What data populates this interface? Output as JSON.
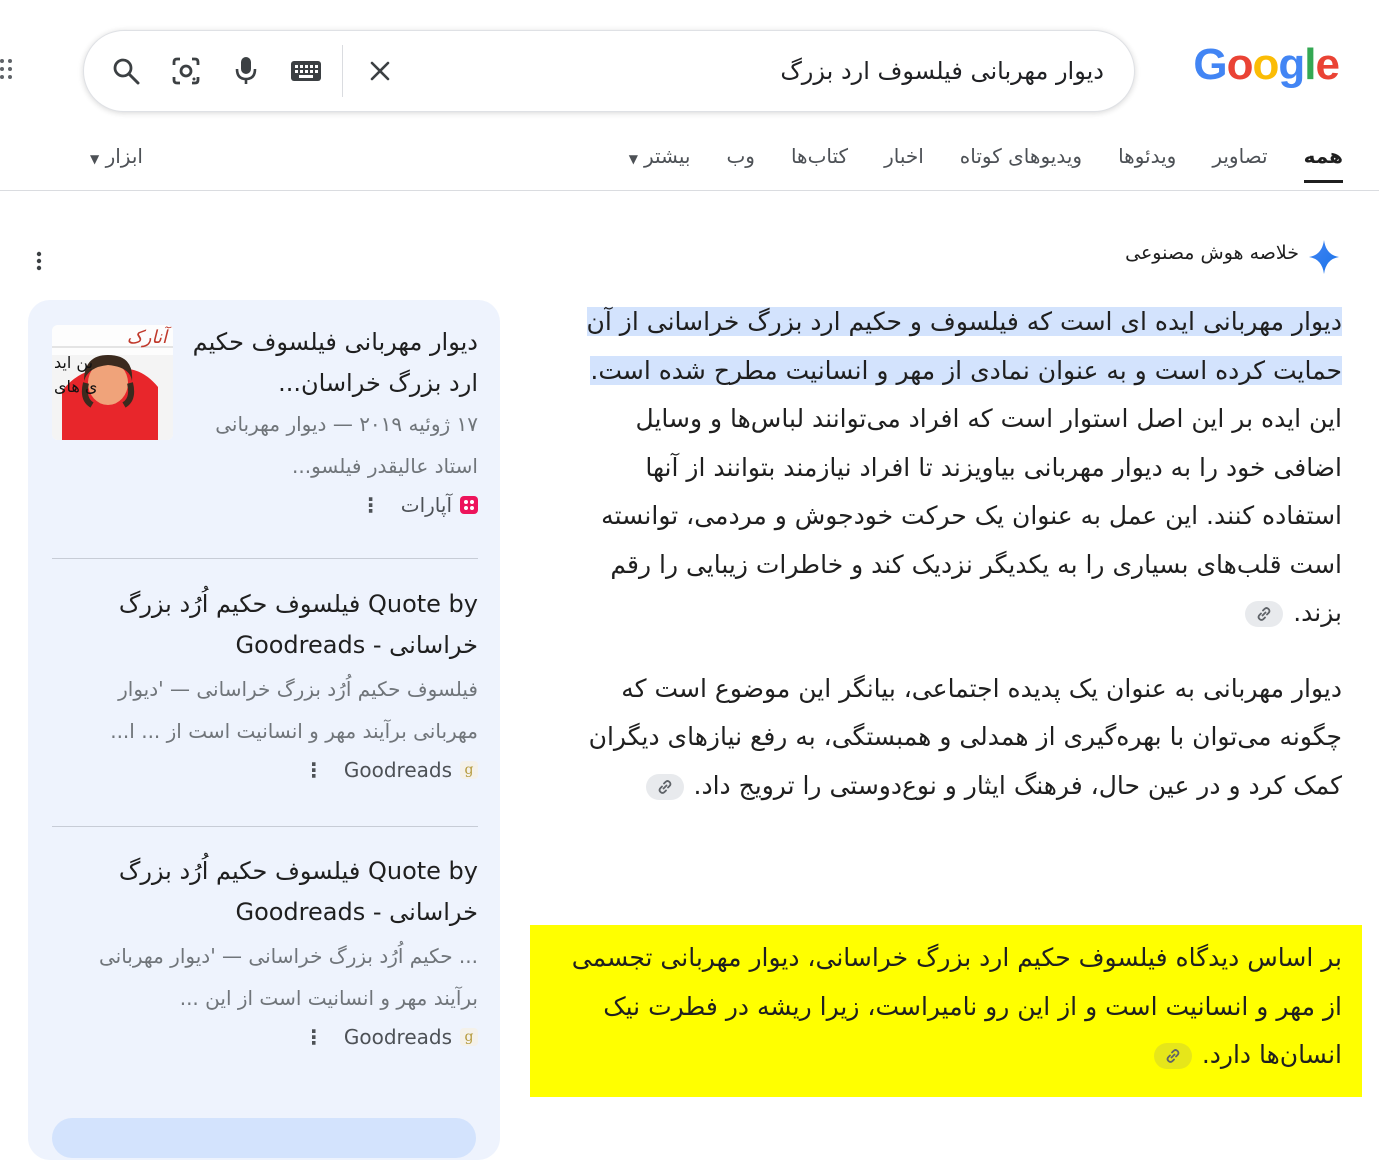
{
  "header": {
    "logo_letters": [
      "G",
      "o",
      "o",
      "g",
      "l",
      "e"
    ],
    "logo_colors": [
      "#4285f4",
      "#ea4335",
      "#fbbc05",
      "#4285f4",
      "#34a853",
      "#ea4335"
    ],
    "search_query": "دیوار مهربانی فیلسوف ارد بزرگ",
    "icons": [
      "search-icon",
      "lens-icon",
      "mic-icon",
      "keyboard-icon",
      "clear-icon",
      "apps-icon"
    ]
  },
  "tabs": {
    "items": [
      "همه",
      "تصاویر",
      "ویدئوها",
      "ویدیوهای کوتاه",
      "اخبار",
      "کتاب‌ها",
      "وب",
      "بیشتر"
    ],
    "active_index": 0,
    "tools_label": "ابزار"
  },
  "ai_overview": {
    "label": "خلاصه هوش مصنوعی",
    "para1_highlight": "دیوار مهربانی ایده ای است که فیلسوف و حکیم ارد بزرگ خراسانی از آن حمایت کرده است و به عنوان نمادی از مهر و انسانیت مطرح شده است.",
    "para1_rest": " این ایده بر این اصل استوار است که افراد می‌توانند لباس‌ها و وسایل اضافی خود را به دیوار مهربانی بیاویزند تا افراد نیازمند بتوانند از آنها استفاده کنند. این عمل به عنوان یک حرکت خودجوش و مردمی، توانسته است قلب‌های بسیاری را به یکدیگر نزدیک کند و خاطرات زیبایی را رقم بزند.",
    "para2": "دیوار مهربانی به عنوان یک پدیده اجتماعی، بیانگر این موضوع است که چگونه می‌توان با بهره‌گیری از همدلی و همبستگی، به رفع نیازهای دیگران کمک کرد و در عین حال، فرهنگ ایثار و نوع‌دوستی را ترویج داد.",
    "para3": "بر اساس دیدگاه فیلسوف حکیم ارد بزرگ خراسانی، دیوار مهربانی تجسمی از مهر و انسانیت است و از این رو نامیراست، زیرا ریشه در فطرت نیک انسان‌ها دارد.",
    "highlight_color": "#d3e3fd",
    "box_color": "#ffff00"
  },
  "sources": [
    {
      "title": "دیوار مهربانی فیلسوف حکیم ارد بزرگ خراسان...",
      "snippet": "۱۷ ژوئیه ۲۰۱۹ — دیوار مهربانی استاد عالیقدر فیلسو...",
      "site": "آپارات",
      "thumb_text1": "آنارک",
      "thumb_text2": "بن اید",
      "thumb_text3": "ی های"
    },
    {
      "title": "Quote by فیلسوف حکیم اُرُد بزرگ خراسانی - Goodreads",
      "snippet": "فیلسوف حکیم اُرُد بزرگ خراسانی — 'دیوار مهربانی برآیند مهر و انسانیت است از ... ا...",
      "site": "Goodreads",
      "fav": "g"
    },
    {
      "title": "Quote by فیلسوف حکیم اُرُد بزرگ خراسانی - Goodreads",
      "snippet": "... حکیم اُرُد بزرگ خراسانی — 'دیوار مهربانی برآیند مهر و انسانیت است از این ...",
      "site": "Goodreads",
      "fav": "g"
    }
  ]
}
